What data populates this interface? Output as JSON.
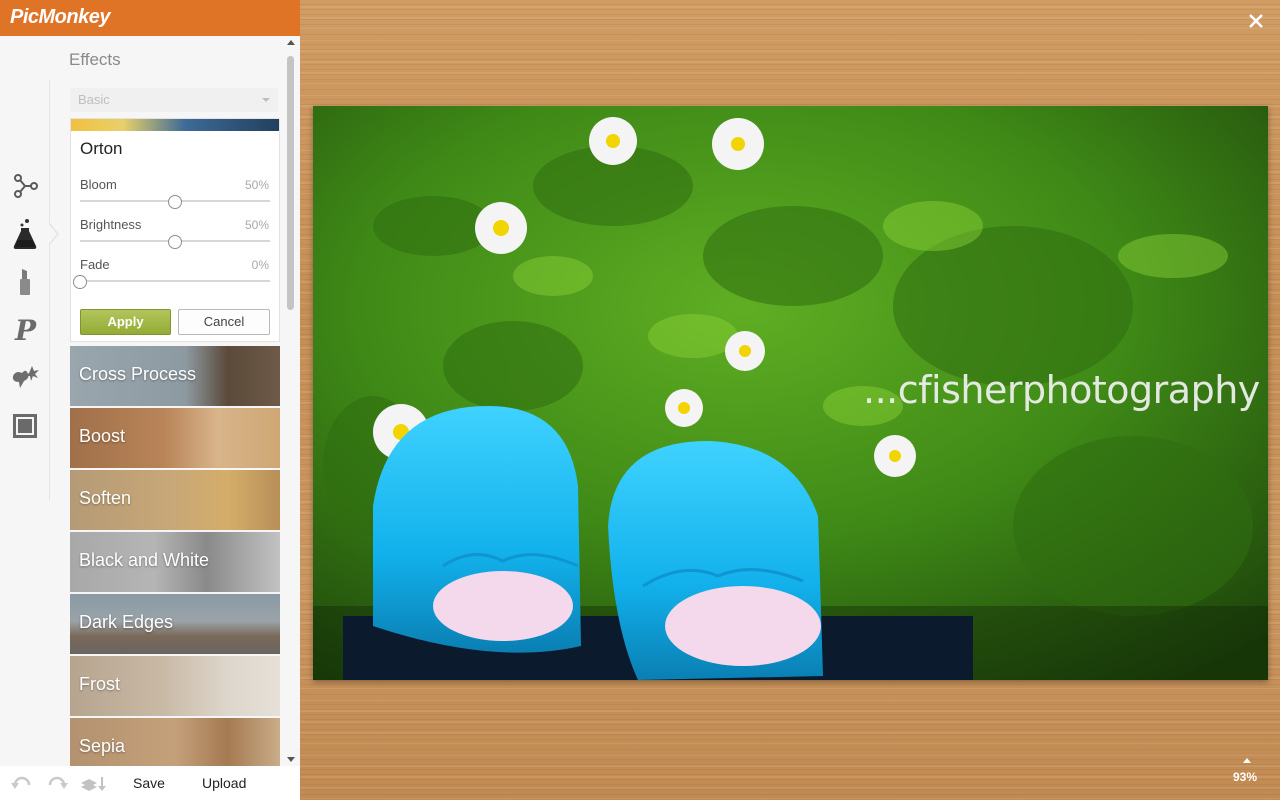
{
  "app": {
    "logo_text": "PicMonkey"
  },
  "panel": {
    "title": "Effects",
    "category_select": {
      "selected": "Basic"
    },
    "active_effect": {
      "name": "Orton",
      "sliders": [
        {
          "label": "Bloom",
          "value_text": "50%",
          "value": 0.5
        },
        {
          "label": "Brightness",
          "value_text": "50%",
          "value": 0.5
        },
        {
          "label": "Fade",
          "value_text": "0%",
          "value": 0.0
        }
      ],
      "apply_label": "Apply",
      "cancel_label": "Cancel"
    },
    "effects": [
      {
        "label": "Cross Process"
      },
      {
        "label": "Boost"
      },
      {
        "label": "Soften"
      },
      {
        "label": "Black and White"
      },
      {
        "label": "Dark Edges"
      },
      {
        "label": "Frost"
      },
      {
        "label": "Sepia"
      }
    ]
  },
  "toolrail": {
    "tools": [
      "basic-edits-icon",
      "effects-icon",
      "touch-up-icon",
      "text-icon",
      "overlays-icon",
      "frames-icon"
    ],
    "active": "effects-icon"
  },
  "bottombar": {
    "save_label": "Save",
    "upload_label": "Upload"
  },
  "canvas": {
    "watermark_text": "...cfisherphotography",
    "zoom_text": "93%"
  },
  "colors": {
    "brand": "#e07426",
    "apply_button": "#9fb544",
    "shoe_blue": "#12b6ef",
    "grass": "#3d8a16"
  }
}
